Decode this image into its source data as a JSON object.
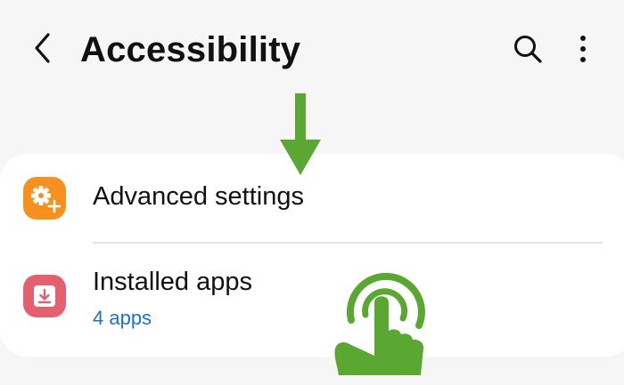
{
  "header": {
    "title": "Accessibility",
    "back_icon": "chevron-left-icon",
    "search_icon": "search-icon",
    "more_icon": "more-vertical-icon"
  },
  "settings": [
    {
      "label": "Advanced settings",
      "icon": "gear-plus-icon",
      "icon_color": "#f6901e"
    },
    {
      "label": "Installed apps",
      "subtitle": "4 apps",
      "icon": "download-icon",
      "icon_color": "#e4606e"
    }
  ],
  "annotations": {
    "arrow_color": "#5aa832",
    "tap_color": "#5aa832"
  },
  "colors": {
    "background": "#f6f6f6",
    "card": "#ffffff",
    "link_blue": "#1a73c9"
  }
}
